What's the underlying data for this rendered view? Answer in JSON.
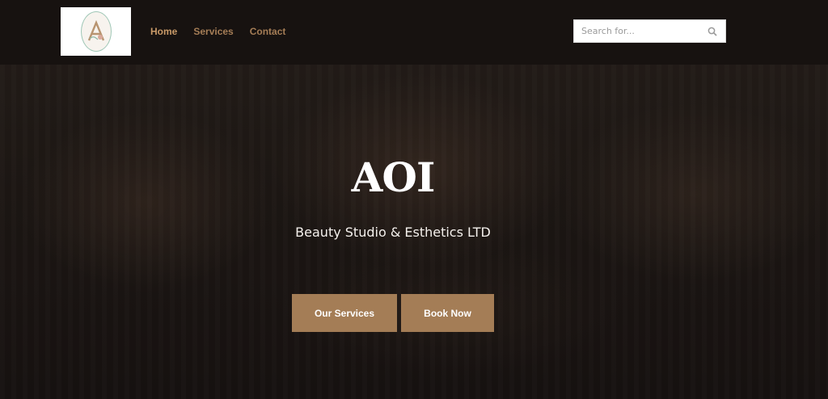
{
  "header": {
    "logo_icon": "aoi-logo-icon",
    "nav": [
      {
        "label": "Home",
        "active": true
      },
      {
        "label": "Services",
        "active": false
      },
      {
        "label": "Contact",
        "active": false
      }
    ],
    "search": {
      "placeholder": "Search for...",
      "icon": "search-icon"
    }
  },
  "hero": {
    "title": "AOI",
    "subtitle": "Beauty Studio & Esthetics LTD",
    "buttons": {
      "services": "Our Services",
      "book": "Book Now"
    }
  },
  "colors": {
    "accent": "#a47d56",
    "nav_link": "#a57d56",
    "background": "#171210"
  }
}
